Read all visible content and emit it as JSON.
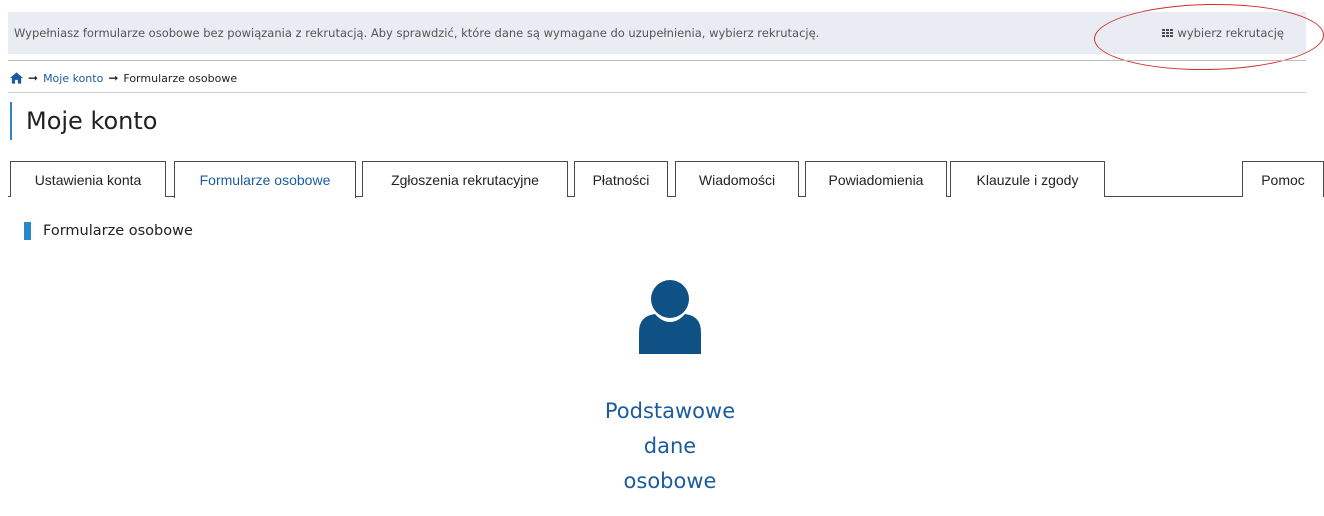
{
  "info_bar": {
    "message": "Wypełniasz formularze osobowe bez powiązania z rekrutacją. Aby sprawdzić, które dane są wymagane do uzupełnienia, wybierz rekrutację.",
    "choose_label": "wybierz rekrutację",
    "choose_icon": "grid-icon"
  },
  "breadcrumb": {
    "home_icon": "home-icon",
    "separator": "➞",
    "items": [
      "Moje konto",
      "Formularze osobowe"
    ]
  },
  "page_title": "Moje konto",
  "tabs": [
    {
      "label": "Ustawienia konta",
      "active": false
    },
    {
      "label": "Formularze osobowe",
      "active": true
    },
    {
      "label": "Zgłoszenia rekrutacyjne",
      "active": false
    },
    {
      "label": "Płatności",
      "active": false
    },
    {
      "label": "Wiadomości",
      "active": false
    },
    {
      "label": "Powiadomienia",
      "active": false
    },
    {
      "label": "Klauzule i zgody",
      "active": false
    },
    {
      "label": "Pomoc",
      "active": false
    }
  ],
  "section_label": "Formularze osobowe",
  "card": {
    "icon": "person-icon",
    "title_lines": [
      "Podstawowe",
      "dane",
      "osobowe"
    ]
  },
  "colors": {
    "accent": "#2a88c9",
    "link": "#1b5c9e",
    "icon": "#0f5185",
    "info_bar_bg": "#e9ecf3",
    "highlight": "#d0302a"
  }
}
